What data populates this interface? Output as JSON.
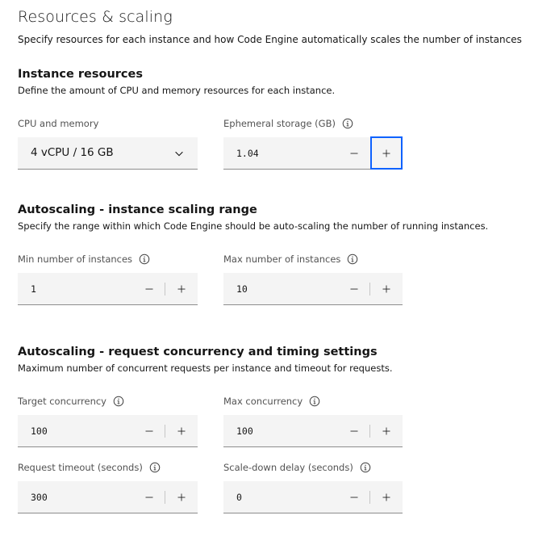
{
  "header": {
    "title": "Resources & scaling",
    "description": "Specify resources for each instance and how Code Engine automatically scales the number of instances"
  },
  "instance_resources": {
    "title": "Instance resources",
    "description": "Define the amount of CPU and memory resources for each instance.",
    "cpu_memory": {
      "label": "CPU and memory",
      "value": "4 vCPU / 16 GB"
    },
    "ephemeral_storage": {
      "label": "Ephemeral storage (GB)",
      "value": "1.04"
    }
  },
  "scaling_range": {
    "title": "Autoscaling - instance scaling range",
    "description": "Specify the range within which Code Engine should be auto-scaling the number of running instances.",
    "min_instances": {
      "label": "Min number of instances",
      "value": "1"
    },
    "max_instances": {
      "label": "Max number of instances",
      "value": "10"
    }
  },
  "concurrency": {
    "title": "Autoscaling - request concurrency and timing settings",
    "description": "Maximum number of concurrent requests per instance and timeout for requests.",
    "target_concurrency": {
      "label": "Target concurrency",
      "value": "100"
    },
    "max_concurrency": {
      "label": "Max concurrency",
      "value": "100"
    },
    "request_timeout": {
      "label": "Request timeout (seconds)",
      "value": "300"
    },
    "scale_down_delay": {
      "label": "Scale-down delay (seconds)",
      "value": "0"
    }
  },
  "icons": {
    "info": "information-icon",
    "chevron": "chevron-down-icon",
    "minus": "minus-icon",
    "plus": "plus-icon"
  },
  "colors": {
    "focus": "#0f62fe",
    "field_background": "#f4f4f4",
    "field_border": "#8d8d8d",
    "label_text": "#525252"
  }
}
